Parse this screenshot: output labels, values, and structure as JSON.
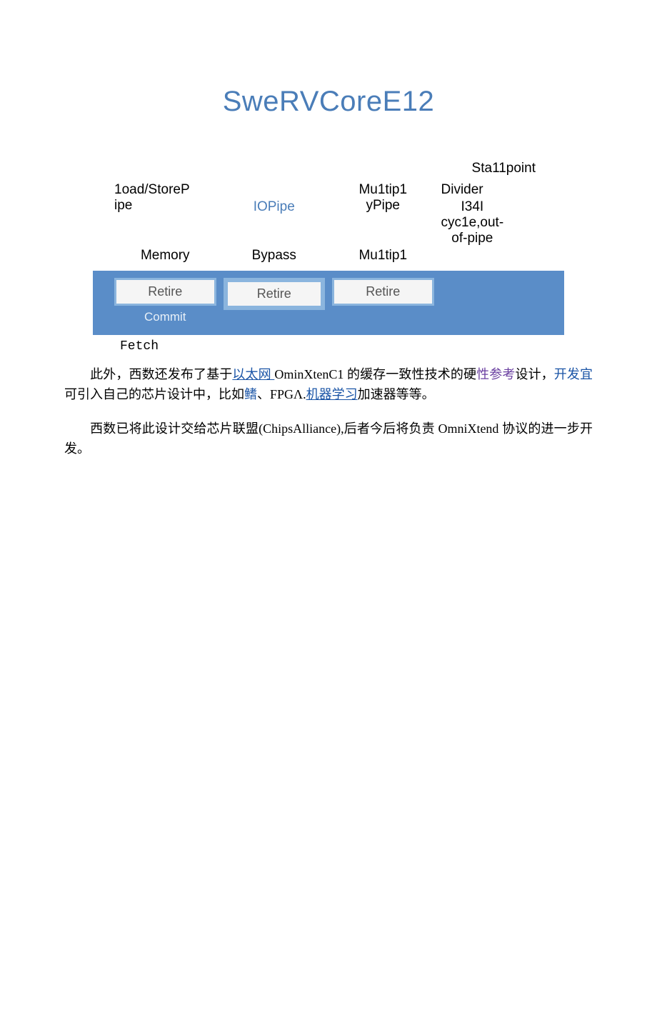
{
  "title": "SweRVCoreE12",
  "diagram": {
    "stallpoint": "Sta11point",
    "cols": {
      "load_store": "1oad/StoreP\nipe",
      "io_pipe": "IOPipe",
      "multiply_pipe": "Mu1tip1\nyPipe",
      "divider": "Divider"
    },
    "subcols": {
      "memory": "Memory",
      "bypass": "Bypass",
      "multipl": "Mu1tip1",
      "divider_cycles": "I34I\ncyc1e,out-\nof-pipe"
    },
    "retire": {
      "r1": "Retire",
      "r2": "Retire",
      "r3": "Retire",
      "commit": "Commit"
    },
    "fetch": "Fetch"
  },
  "body": {
    "p1_a": "此外，西数还发布了基于",
    "p1_link1": "以太网 ",
    "p1_b": "OminXtenC1 的缓存一致性技术的硬",
    "p1_purple1": "性参考",
    "p1_c": "设计，",
    "p1_link2": "开发宜",
    "p1_d": "可引入自己的芯片设计中，比如",
    "p1_link3": "鳍",
    "p1_e": "、FPGΛ.",
    "p1_link4": "机器学习",
    "p1_f": "加速器等等。",
    "p2": "西数已将此设计交给芯片联盟(ChipsAlliance),后者今后将负责 OmniXtend 协议的进一步开发。"
  }
}
